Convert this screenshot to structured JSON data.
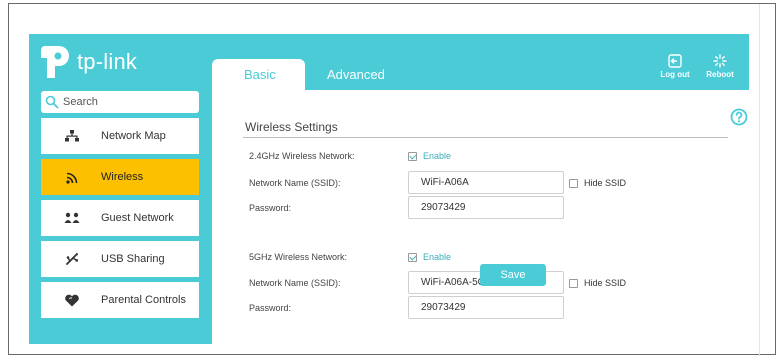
{
  "brand": {
    "logo_text": "tp-link",
    "accent": "#4acbd6",
    "highlight": "#fcc000"
  },
  "tabs": [
    {
      "label": "Basic",
      "active": true
    },
    {
      "label": "Advanced",
      "active": false
    }
  ],
  "header": {
    "logout_label": "Log out",
    "logout_icon": "logout-icon",
    "reboot_label": "Reboot",
    "reboot_icon": "reboot-icon"
  },
  "sidebar": {
    "search_placeholder": "Search",
    "items": [
      {
        "label": "Network Map",
        "icon": "network-map-icon",
        "active": false
      },
      {
        "label": "Wireless",
        "icon": "wifi-icon",
        "active": true
      },
      {
        "label": "Guest Network",
        "icon": "guest-network-icon",
        "active": false
      },
      {
        "label": "USB Sharing",
        "icon": "usb-icon",
        "active": false
      },
      {
        "label": "Parental Controls",
        "icon": "heart-icon",
        "active": false
      }
    ]
  },
  "content": {
    "section_title": "Wireless Settings",
    "help_icon": "help-icon",
    "band_24": {
      "label": "2.4GHz Wireless Network:",
      "enable_label": "Enable",
      "enable_checked": true,
      "ssid_label": "Network Name (SSID):",
      "ssid_value": "WiFi-A06A",
      "hide_ssid_label": "Hide SSID",
      "hide_ssid_checked": false,
      "password_label": "Password:",
      "password_value": "29073429"
    },
    "band_5": {
      "label": "5GHz Wireless Network:",
      "enable_label": "Enable",
      "enable_checked": true,
      "ssid_label": "Network Name (SSID):",
      "ssid_value": "WiFi-A06A-5G",
      "hide_ssid_label": "Hide SSID",
      "hide_ssid_checked": false,
      "password_label": "Password:",
      "password_value": "29073429"
    },
    "save_label": "Save"
  }
}
